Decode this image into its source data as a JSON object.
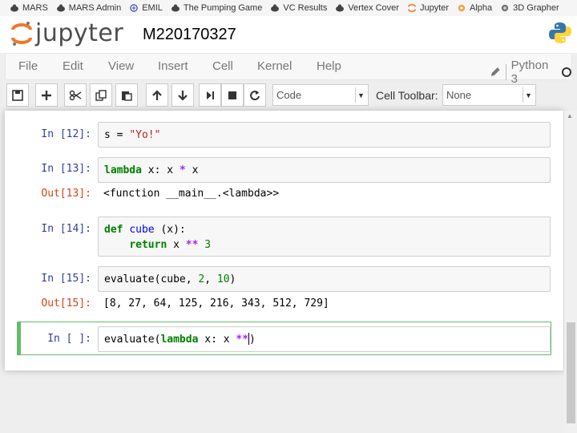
{
  "bookmarks": [
    "MARS",
    "MARS Admin",
    "EMIL",
    "The Pumping Game",
    "VC Results",
    "Vertex Cover",
    "Jupyter",
    "Alpha",
    "3D Grapher"
  ],
  "header": {
    "logo_text": "jupyter",
    "notebook_name": "M220170327"
  },
  "menu": [
    "File",
    "Edit",
    "View",
    "Insert",
    "Cell",
    "Kernel",
    "Help"
  ],
  "kernel": {
    "name": "Python 3"
  },
  "toolbar": {
    "cell_type": "Code",
    "cell_toolbar_label": "Cell Toolbar:",
    "cell_toolbar_value": "None"
  },
  "cells": [
    {
      "prompt": "In [12]:",
      "code": "s = \"Yo!\""
    },
    {
      "prompt": "In [13]:",
      "code": "lambda x: x * x",
      "out_prompt": "Out[13]:",
      "output": "<function __main__.<lambda>>"
    },
    {
      "prompt": "In [14]:",
      "code": "def cube (x):\n    return x ** 3"
    },
    {
      "prompt": "In [15]:",
      "code": "evaluate(cube, 2, 10)",
      "out_prompt": "Out[15]:",
      "output": "[8, 27, 64, 125, 216, 343, 512, 729]"
    },
    {
      "prompt": "In [ ]:",
      "code": "evaluate(lambda x: x **)"
    }
  ],
  "colors": {
    "in_prompt": "#303f9f",
    "out_prompt": "#d84315",
    "selected_border": "#66bb6a",
    "keyword": "#008000"
  }
}
